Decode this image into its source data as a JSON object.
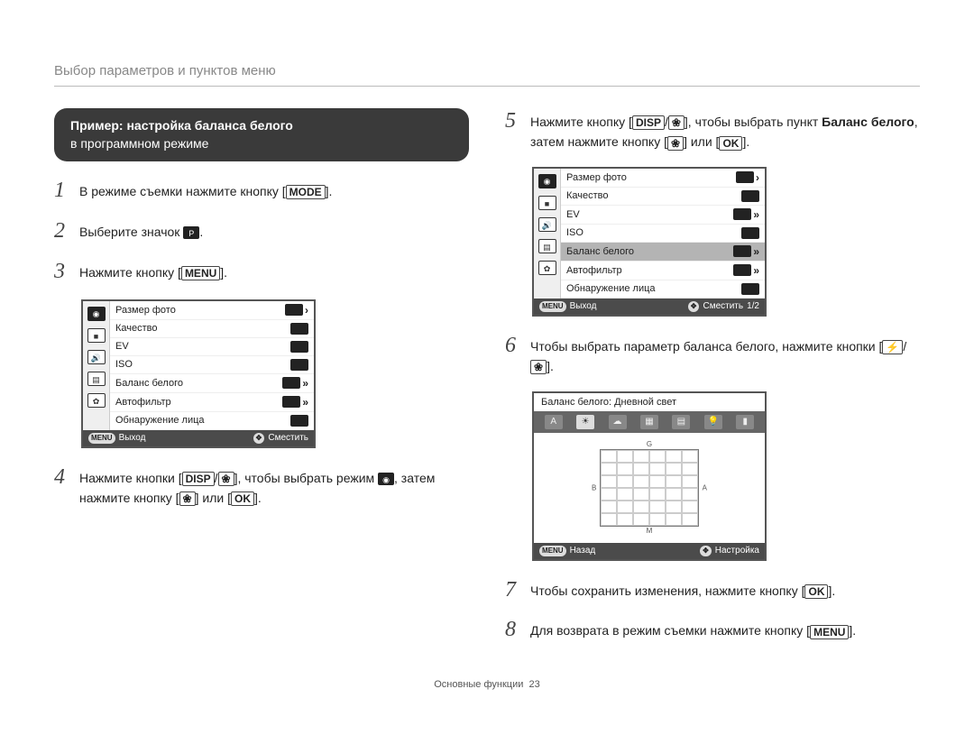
{
  "page_title": "Выбор параметров и пунктов меню",
  "box": {
    "line1": "Пример: настройка баланса белого",
    "line2": "в программном режиме"
  },
  "steps": {
    "s1_pre": "В режиме съемки нажмите кнопку [",
    "s1_key": "MODE",
    "s1_post": "].",
    "s2_pre": "Выберите значок ",
    "s2_post": ".",
    "s3_pre": "Нажмите кнопку [",
    "s3_key": "MENU",
    "s3_post": "].",
    "s4_pre": "Нажмите кнопки [",
    "s4_key1": "DISP",
    "s4_mid1": "/",
    "s4_mid2": "], чтобы выбрать режим ",
    "s4_mid3": ", затем нажмите кнопку [",
    "s4_mid4": "] или [",
    "s4_key_ok": "OK",
    "s4_post": "].",
    "s5_pre": "Нажмите кнопку [",
    "s5_key1": "DISP",
    "s5_mid1": "/",
    "s5_mid2": "], чтобы выбрать пункт ",
    "s5_bold": "Баланс белого",
    "s5_mid3": ", затем нажмите кнопку [",
    "s5_mid4": "] или [",
    "s5_key_ok": "OK",
    "s5_post": "].",
    "s6_pre": "Чтобы выбрать параметр баланса белого, нажмите кнопки [",
    "s6_mid1": "/",
    "s6_post": "].",
    "s7_pre": "Чтобы сохранить изменения, нажмите кнопку [",
    "s7_key": "OK",
    "s7_post": "].",
    "s8_pre": "Для возврата в режим съемки нажмите кнопку [",
    "s8_key": "MENU",
    "s8_post": "]."
  },
  "menu": {
    "rows": [
      {
        "label": "Размер фото"
      },
      {
        "label": "Качество"
      },
      {
        "label": "EV"
      },
      {
        "label": "ISO"
      },
      {
        "label": "Баланс белого"
      },
      {
        "label": "Автофильтр"
      },
      {
        "label": "Обнаружение лица"
      }
    ],
    "footer_left_key": "MENU",
    "footer_left": "Выход",
    "footer_right": "Сместить",
    "page_ind": "1/2"
  },
  "wb": {
    "title": "Баланс белого: Дневной свет",
    "footer_left_key": "MENU",
    "footer_left": "Назад",
    "footer_right": "Настройка",
    "axis_top": "G",
    "axis_bottom": "M",
    "axis_left": "B",
    "axis_right": "A"
  },
  "icons": {
    "mode_p": "P",
    "flower": "❀",
    "camera": "📷",
    "macro": "❀",
    "flash": "⚡",
    "sun": "☀",
    "cloud": "☁",
    "bulb1": "💡",
    "bulb2": "▦",
    "bulb3": "▤",
    "custom": "▮"
  },
  "footer": {
    "section": "Основные функции",
    "page": "23"
  }
}
